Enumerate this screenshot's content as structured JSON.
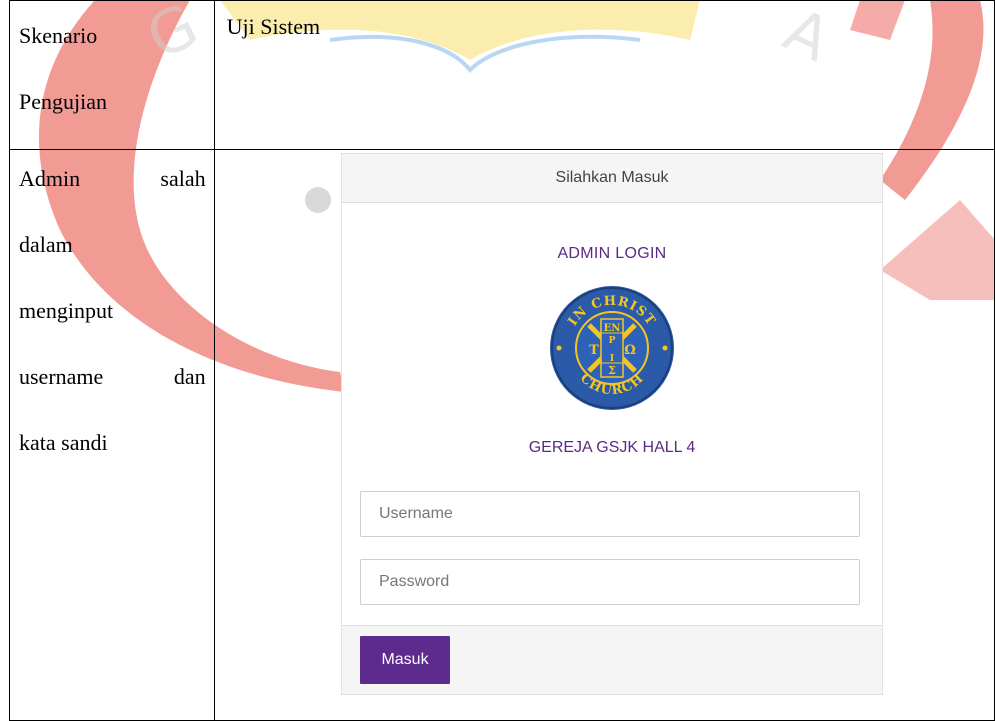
{
  "table": {
    "row1_left": [
      "Skenario",
      "Pengujian"
    ],
    "row1_right": "Uji Sistem",
    "row2_left": {
      "line1": [
        "Admin",
        "salah"
      ],
      "line2": "dalam",
      "line3": "menginput",
      "line4": [
        "username",
        "dan"
      ],
      "line5": "kata sandi"
    }
  },
  "login": {
    "header": "Silahkan Masuk",
    "title": "ADMIN LOGIN",
    "seal": {
      "top_text": "IN CHRIST",
      "bottom_text": "CHURCH",
      "glyph_top": "EN",
      "glyph_p": "P",
      "glyph_left": "T",
      "glyph_right": "Ω",
      "glyph_i": "I",
      "glyph_bottom": "Σ"
    },
    "church": "GEREJA GSJK HALL 4",
    "username_placeholder": "Username",
    "password_placeholder": "Password",
    "submit_label": "Masuk"
  },
  "colors": {
    "accent": "#5d2a8e",
    "watermark_red": "#e53935",
    "watermark_yellow": "#f7d64a"
  }
}
